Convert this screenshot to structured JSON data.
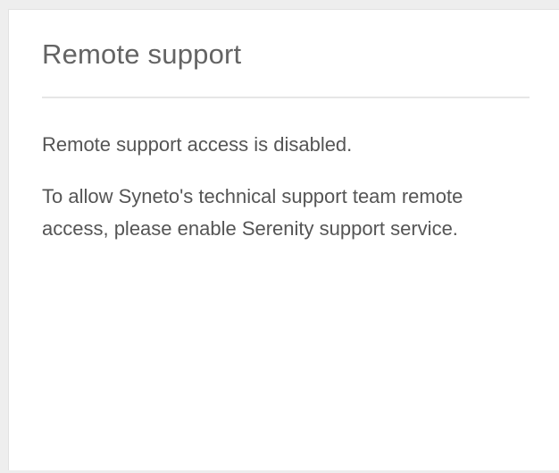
{
  "panel": {
    "title": "Remote support",
    "status": "Remote support access is disabled.",
    "message": "To allow Syneto's technical support team remote access, please enable Serenity support service."
  },
  "colors": {
    "background": "#eeeeee",
    "card": "#ffffff",
    "title_text": "#646464",
    "body_text": "#555555",
    "divider": "#e6e6e6"
  }
}
